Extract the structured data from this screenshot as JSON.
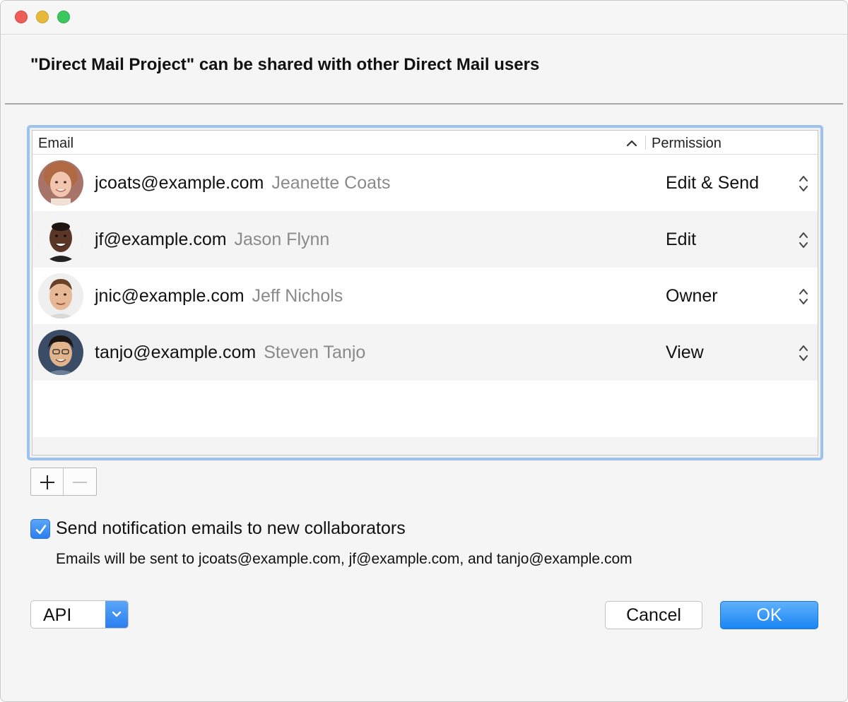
{
  "window": {
    "controls": [
      "close-icon",
      "minimize-icon",
      "zoom-icon"
    ]
  },
  "heading": "\"Direct Mail Project\" can be shared with other Direct Mail users",
  "table": {
    "columns": {
      "email": "Email",
      "permission": "Permission"
    },
    "sort_icon": "chevron-up-icon",
    "rows": [
      {
        "email": "jcoats@example.com",
        "name": "Jeanette Coats",
        "permission": "Edit & Send",
        "avatar": "avatar-jeanette"
      },
      {
        "email": "jf@example.com",
        "name": "Jason Flynn",
        "permission": "Edit",
        "avatar": "avatar-jason"
      },
      {
        "email": "jnic@example.com",
        "name": "Jeff Nichols",
        "permission": "Owner",
        "avatar": "avatar-jeff"
      },
      {
        "email": "tanjo@example.com",
        "name": "Steven Tanjo",
        "permission": "View",
        "avatar": "avatar-steven"
      }
    ]
  },
  "controls": {
    "add_icon": "plus-icon",
    "remove_icon": "minus-icon"
  },
  "notify": {
    "checked": true,
    "label": "Send notification emails to new collaborators",
    "note": "Emails will be sent to jcoats@example.com, jf@example.com, and tanjo@example.com"
  },
  "footer": {
    "popup_value": "API",
    "cancel_label": "Cancel",
    "ok_label": "OK"
  },
  "colors": {
    "accent": "#2a7ff0",
    "focus_ring": "#9cc3ee",
    "secondary_text": "#8a8a8a"
  }
}
